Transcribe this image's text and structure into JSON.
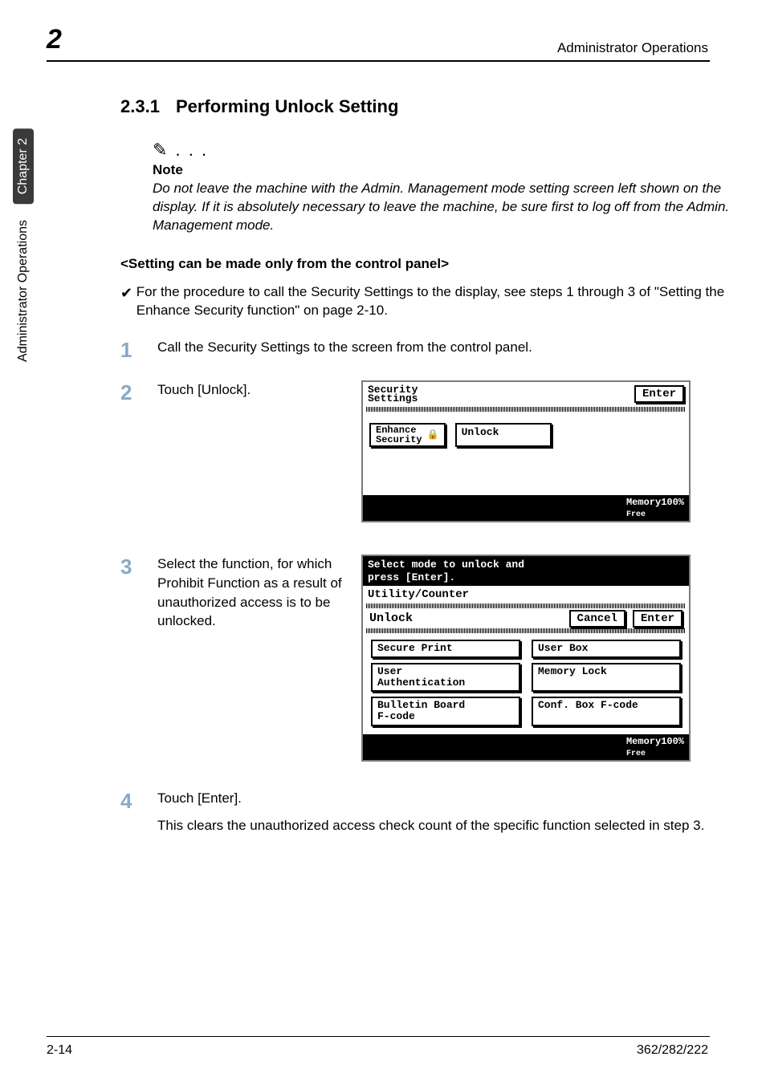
{
  "header": {
    "chapter_num": "2",
    "right": "Administrator Operations"
  },
  "sidebar": {
    "tab1": "Chapter 2",
    "tab2": "Administrator Operations"
  },
  "section": {
    "number": "2.3.1",
    "title": "Performing Unlock Setting"
  },
  "note": {
    "icon": "✎ . . .",
    "label": "Note",
    "body": "Do not leave the machine with the Admin. Management mode setting screen left shown on the display. If it is absolutely necessary to leave the machine, be sure first to log off from the Admin. Management mode."
  },
  "subhead": "<Setting can be made only from the control panel>",
  "check": {
    "mark": "✔",
    "text": "For the procedure to call the Security Settings to the display, see steps 1 through 3 of \"Setting the Enhance Security function\" on page 2-10."
  },
  "steps": {
    "s1": {
      "num": "1",
      "text": "Call the Security Settings to the screen from the control panel."
    },
    "s2": {
      "num": "2",
      "text": "Touch [Unlock]."
    },
    "s3": {
      "num": "3",
      "text": "Select the function, for which Prohibit Function as a result of unauthorized access is to be unlocked."
    },
    "s4": {
      "num": "4",
      "text": "Touch [Enter]."
    },
    "s4b": "This clears the unauthorized access check count of the specific function selected in step 3."
  },
  "lcd1": {
    "title_l1": "Security",
    "title_l2": "Settings",
    "enter": "Enter",
    "enhance_l1": "Enhance",
    "enhance_l2": "Security",
    "lock_icon": "🔒",
    "unlock": "Unlock",
    "mem_l1": "Memory",
    "mem_l2": "Free",
    "mem_pct": "100%"
  },
  "lcd2": {
    "top_l1": "Select mode to unlock and",
    "top_l2": "press [Enter].",
    "util": "Utility/Counter",
    "unlock": "Unlock",
    "cancel": "Cancel",
    "enter": "Enter",
    "cells": {
      "c1": "Secure Print",
      "c2": "User Box",
      "c3a": "User",
      "c3b": "Authentication",
      "c4": "Memory Lock",
      "c5a": "Bulletin Board",
      "c5b": "F-code",
      "c6": "Conf. Box F-code"
    },
    "mem_l1": "Memory",
    "mem_l2": "Free",
    "mem_pct": "100%"
  },
  "footer": {
    "left": "2-14",
    "right": "362/282/222"
  }
}
